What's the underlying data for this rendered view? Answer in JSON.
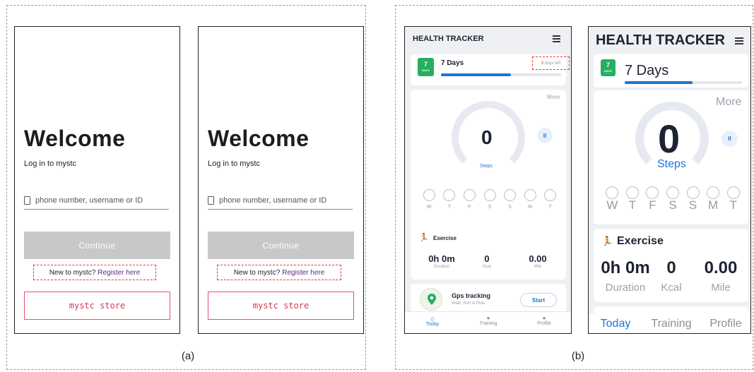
{
  "captions": {
    "a": "(a)",
    "b": "(b)"
  },
  "login": {
    "title": "Welcome",
    "subtitle": "Log in to mystc",
    "placeholder": "phone number, username or ID",
    "continue_label": "Continue",
    "register_prefix": "New to mystc?",
    "register_link": "Register here",
    "store_label": "mystc store"
  },
  "tracker": {
    "title": "HEALTH TRACKER",
    "badge_number": "7",
    "badge_sub": "DAYS",
    "days_label": "7 Days",
    "days_left_count": "3",
    "days_left_text": "days left",
    "progress": 0.58,
    "more_label": "More",
    "steps_value": "0",
    "steps_label": "Steps",
    "week_days": [
      "W",
      "T",
      "F",
      "S",
      "S",
      "M",
      "T"
    ],
    "exercise_title": "Exercise",
    "stats": [
      {
        "value": "0h 0m",
        "label": "Duration"
      },
      {
        "value": "0",
        "label": "Kcal"
      },
      {
        "value": "0.00",
        "label": "Mile"
      }
    ],
    "gps_title": "Gps tracking",
    "gps_sub": "Walk, Run & Ride",
    "start_label": "Start",
    "tabs": [
      {
        "label": "Today",
        "icon": "home-icon"
      },
      {
        "label": "Training",
        "icon": "flame-icon"
      },
      {
        "label": "Profile",
        "icon": "person-icon"
      }
    ]
  },
  "colors": {
    "accent": "#1e74d6",
    "badge_green": "#27ae60",
    "store_red": "#d63a57",
    "dashed_red": "#e53935"
  }
}
